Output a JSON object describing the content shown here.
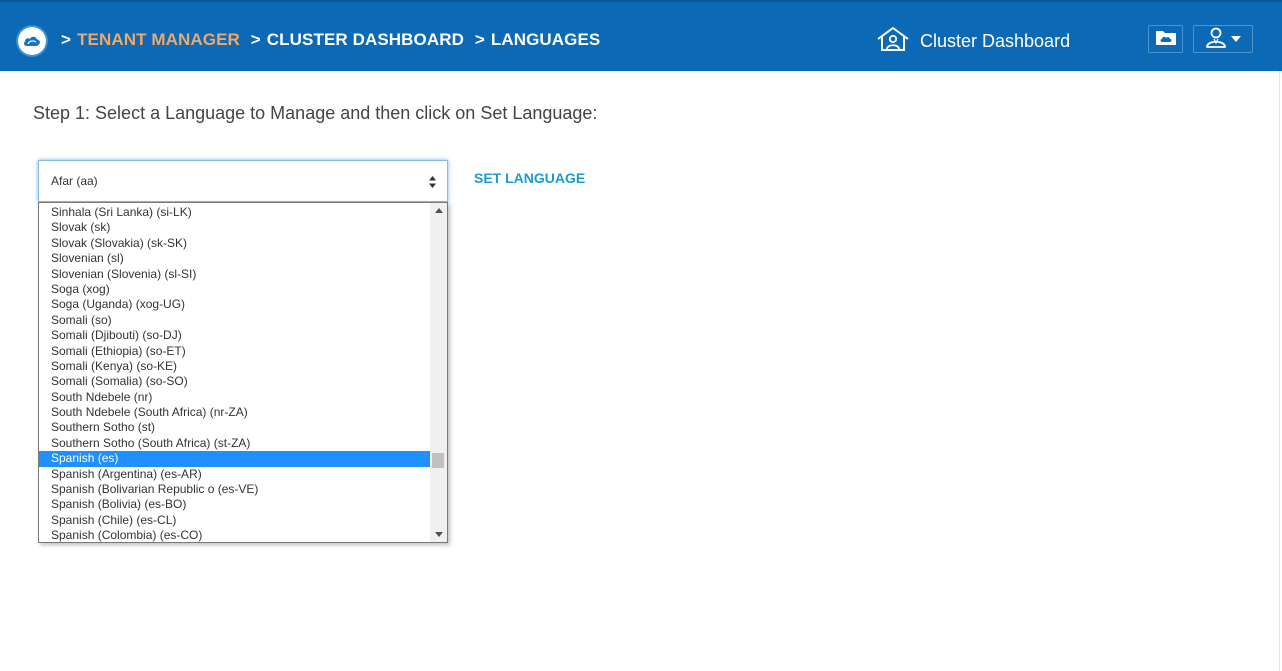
{
  "header": {
    "breadcrumb": {
      "tenant_manager": "TENANT MANAGER",
      "cluster_dashboard": "CLUSTER DASHBOARD",
      "languages": "LANGUAGES"
    },
    "separator": ">",
    "dashboard_link": "Cluster Dashboard"
  },
  "main": {
    "step_text": "Step 1: Select a Language to Manage and then click on Set Language:",
    "select": {
      "value": "Afar (aa)"
    },
    "set_language": "SET LANGUAGE",
    "options": [
      "Sinhala (Sri Lanka) (si-LK)",
      "Slovak (sk)",
      "Slovak (Slovakia) (sk-SK)",
      "Slovenian (sl)",
      "Slovenian (Slovenia) (sl-SI)",
      "Soga (xog)",
      "Soga (Uganda) (xog-UG)",
      "Somali (so)",
      "Somali (Djibouti) (so-DJ)",
      "Somali (Ethiopia) (so-ET)",
      "Somali (Kenya) (so-KE)",
      "Somali (Somalia) (so-SO)",
      "South Ndebele (nr)",
      "South Ndebele (South Africa) (nr-ZA)",
      "Southern Sotho (st)",
      "Southern Sotho (South Africa) (st-ZA)",
      "Spanish (es)",
      "Spanish (Argentina) (es-AR)",
      "Spanish (Bolivarian Republic o (es-VE)",
      "Spanish (Bolivia) (es-BO)",
      "Spanish (Chile) (es-CL)",
      "Spanish (Colombia) (es-CO)"
    ],
    "highlighted_option": "Spanish (es)"
  },
  "colors": {
    "header_bg": "#0c69b5",
    "tenant_link": "#f0a868",
    "accent_link": "#1b9ad6",
    "highlight": "#1e90ff"
  },
  "icons": {
    "logo": "cloud-logo-icon",
    "dashboard": "house-user-icon",
    "folder": "cloud-folder-icon",
    "user": "user-icon",
    "caret": "caret-down-icon"
  }
}
